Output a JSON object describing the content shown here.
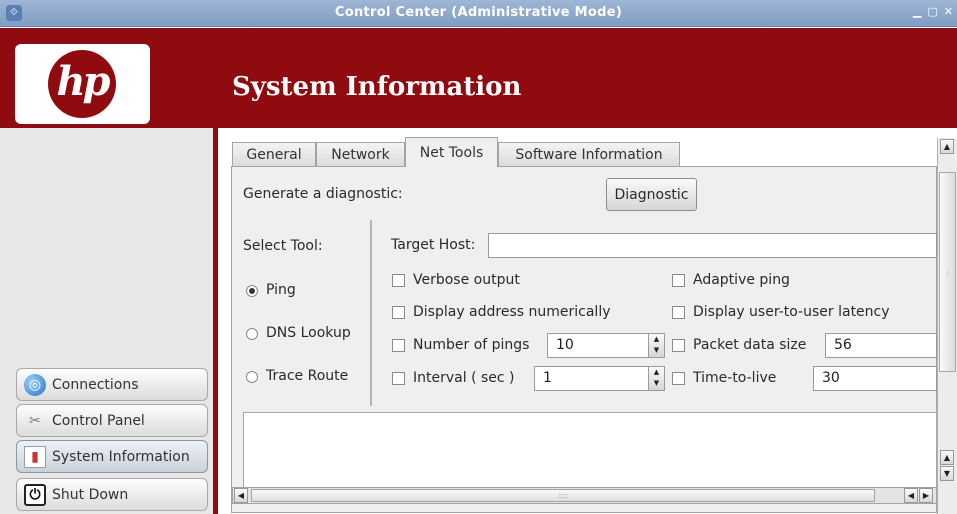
{
  "window": {
    "title": "Control Center (Administrative Mode)",
    "logo_text": "hp"
  },
  "banner": {
    "heading": "System Information"
  },
  "sidebar": {
    "items": [
      {
        "label": "Connections",
        "icon": "globe-icon"
      },
      {
        "label": "Control Panel",
        "icon": "tools-icon"
      },
      {
        "label": "System Information",
        "icon": "system-info-icon"
      },
      {
        "label": "Shut Down",
        "icon": "power-icon"
      }
    ]
  },
  "tabs": [
    "General",
    "Network",
    "Net Tools",
    "Software Information"
  ],
  "active_tab": "Net Tools",
  "diagnostic": {
    "label": "Generate a diagnostic:",
    "button": "Diagnostic"
  },
  "select_tool": {
    "label": "Select Tool:",
    "options": [
      "Ping",
      "DNS Lookup",
      "Trace Route"
    ],
    "selected": "Ping"
  },
  "target_host": {
    "label": "Target Host:",
    "value": ""
  },
  "options": {
    "verbose": "Verbose output",
    "adaptive": "Adaptive ping",
    "numeric": "Display address numerically",
    "latency": "Display user-to-user latency",
    "num_pings": {
      "label": "Number of pings",
      "value": "10"
    },
    "packet_size": {
      "label": "Packet data size",
      "value": "56"
    },
    "interval": {
      "label": "Interval ( sec )",
      "value": "1"
    },
    "ttl": {
      "label": "Time-to-live",
      "value": "30"
    }
  },
  "output_text": "",
  "colors": {
    "brand": "#8f0b10",
    "titlebar": "#8fa9cc"
  }
}
